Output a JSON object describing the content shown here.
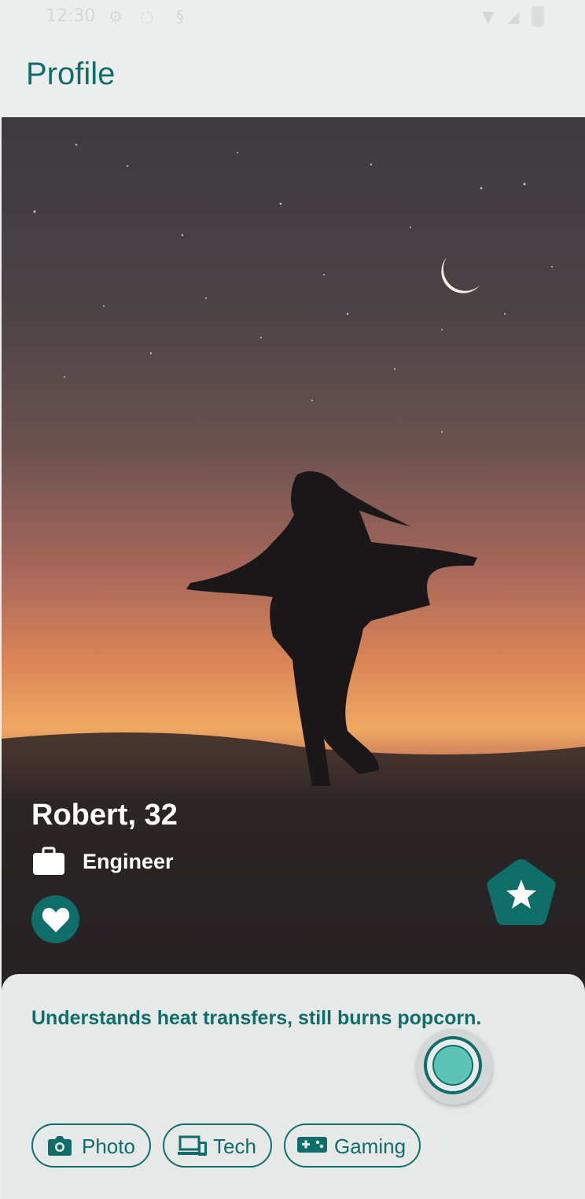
{
  "status_bar": {
    "time": "12:30"
  },
  "app_bar": {
    "title": "Profile"
  },
  "profile": {
    "name_age": "Robert, 32",
    "occupation": "Engineer",
    "bio": "Understands heat transfers, still burns popcorn."
  },
  "interests": [
    {
      "label": "Photo",
      "icon": "camera-icon"
    },
    {
      "label": "Tech",
      "icon": "devices-icon"
    },
    {
      "label": "Gaming",
      "icon": "gamepad-icon"
    }
  ],
  "colors": {
    "accent": "#0f6e69",
    "accent_light": "#5cc3b6",
    "surface": "#e6e9e8",
    "background": "#eceeed"
  }
}
